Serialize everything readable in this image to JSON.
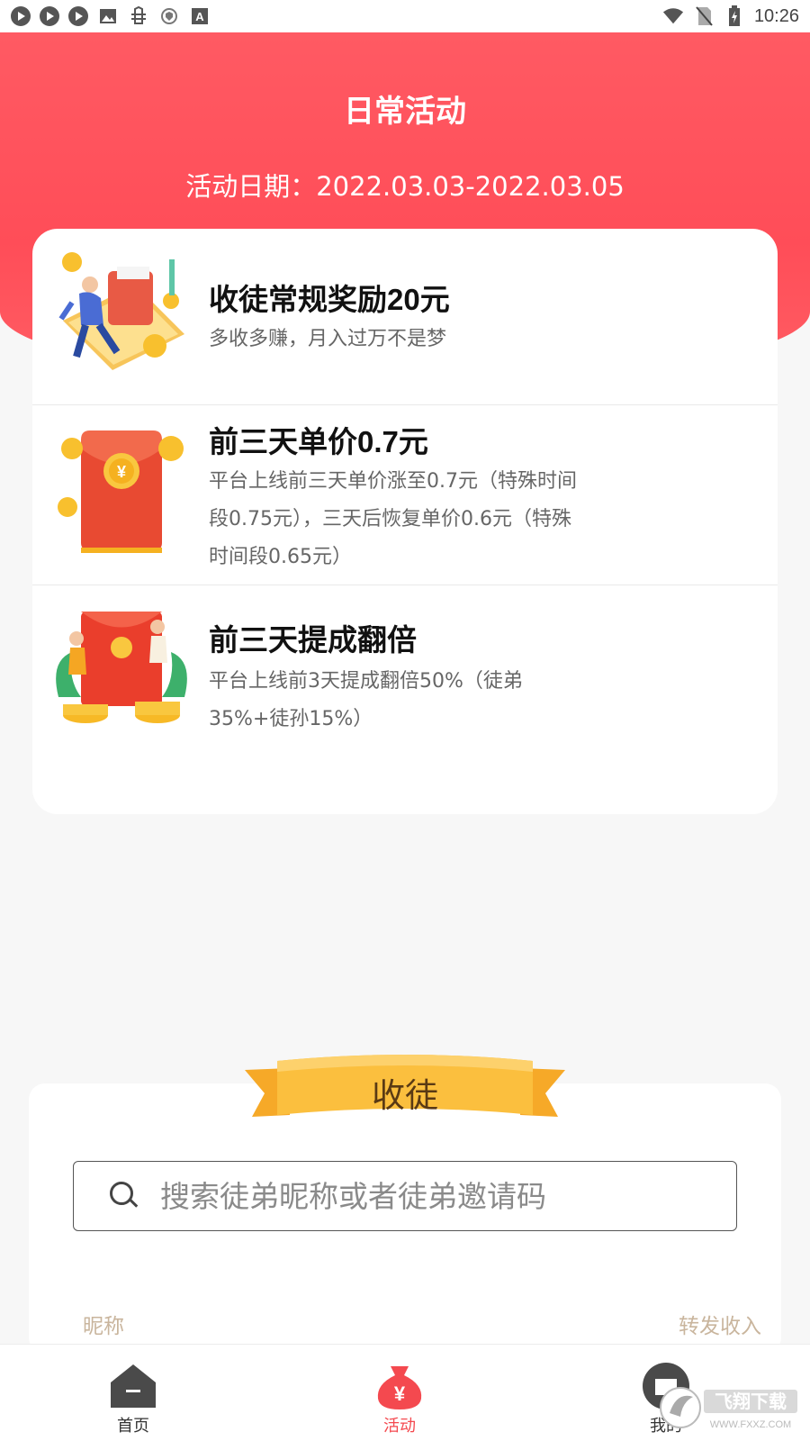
{
  "status_bar": {
    "time": "10:26",
    "left_icons": [
      "play-circle-icon",
      "play-circle-icon",
      "play-circle-icon",
      "image-icon",
      "bug-icon",
      "shield-icon",
      "font-icon"
    ],
    "right_icons": [
      "wifi-icon",
      "no-sim-icon",
      "battery-charging-icon"
    ]
  },
  "header": {
    "title": "日常活动",
    "date": "活动日期：2022.03.03-2022.03.05",
    "color": "#ff4d58"
  },
  "activities": [
    {
      "title": "收徒常规奖励20元",
      "desc": "多收多赚，月入过万不是梦",
      "icon": "wallet-illustration-icon"
    },
    {
      "title": "前三天单价0.7元",
      "desc": "平台上线前三天单价涨至0.7元（特殊时间段0.75元），三天后恢复单价0.6元（特殊时间段0.65元）",
      "icon": "red-envelope-illustration-icon"
    },
    {
      "title": "前三天提成翻倍",
      "desc": "平台上线前3天提成翻倍50%（徒弟35%+徒孙15%）",
      "icon": "red-envelope-people-illustration-icon"
    }
  ],
  "recruit": {
    "ribbon_title": "收徒",
    "search_placeholder": "搜索徒弟昵称或者徒弟邀请码",
    "col_nickname": "昵称",
    "col_income": "转发收入"
  },
  "bottom_nav": {
    "items": [
      {
        "label": "首页",
        "icon": "home-icon",
        "active": false
      },
      {
        "label": "活动",
        "icon": "money-bag-icon",
        "active": true
      },
      {
        "label": "我的",
        "icon": "profile-icon",
        "active": false
      }
    ],
    "active_color": "#f4494f",
    "inactive_color": "#333333"
  },
  "watermark": {
    "text": "飞翔下载",
    "subtext": "WWW.FXXZ.COM"
  }
}
